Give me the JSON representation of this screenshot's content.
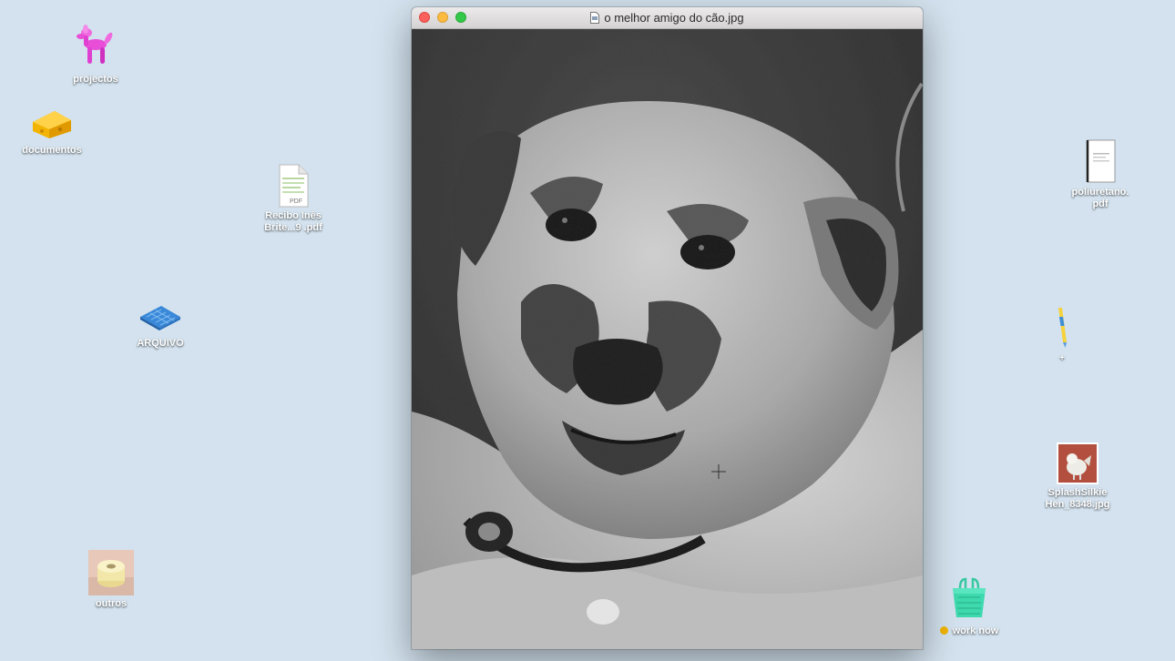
{
  "desktop": {
    "background": "#d3e2ee",
    "icons": {
      "projectos": {
        "label": "projectos",
        "icon": "balloon-dog-icon"
      },
      "documentos": {
        "label": "documentos",
        "icon": "cheese-icon"
      },
      "recibo": {
        "label": "Recibo Inês\nBrite...9 .pdf",
        "icon": "pdf-file-icon"
      },
      "arquivo": {
        "label": "ARQUIVO",
        "icon": "blue-mat-icon"
      },
      "outros": {
        "label": "outros",
        "icon": "toilet-roll-icon"
      },
      "poliuretano": {
        "label": "poliuretano.\npdf",
        "icon": "pdf-document-icon"
      },
      "plus": {
        "label": "+",
        "icon": "pencil-icon"
      },
      "splash": {
        "label": "SplashSilkie\nHen_8348.jpg",
        "icon": "jpg-thumbnail-icon"
      },
      "worknow": {
        "label": "work now",
        "icon": "basket-icon",
        "tag_color": "#f0b400"
      }
    }
  },
  "window": {
    "title": "o melhor amigo do cão.jpg",
    "content": "grayscale photograph of a dog"
  }
}
